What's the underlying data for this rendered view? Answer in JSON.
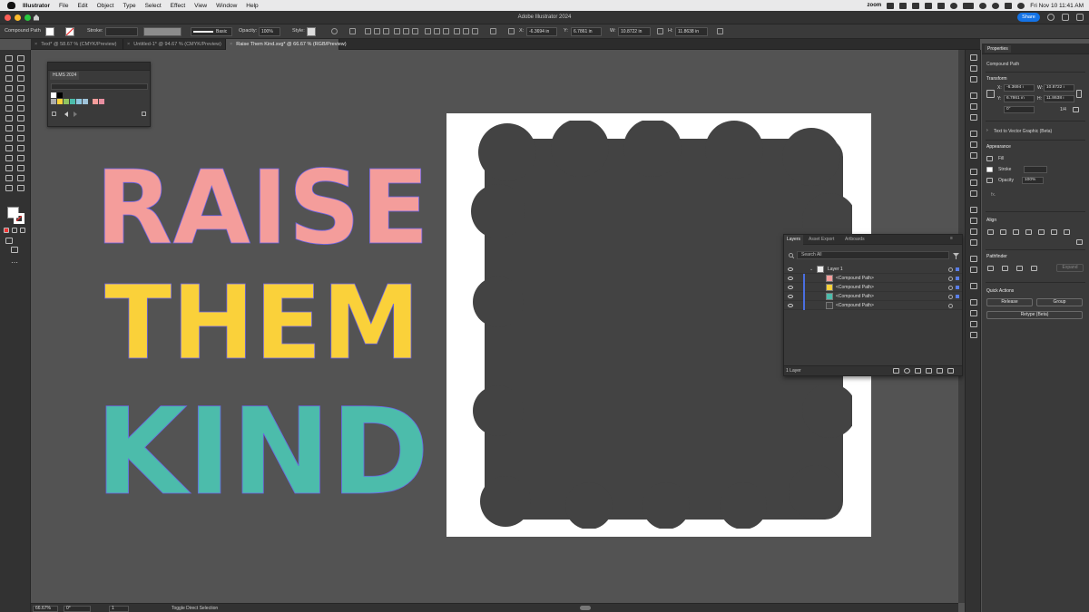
{
  "menubar": {
    "app": "Illustrator",
    "items": [
      "File",
      "Edit",
      "Object",
      "Type",
      "Select",
      "Effect",
      "View",
      "Window",
      "Help"
    ],
    "zoom": "zoom",
    "clock": "Fri Nov 10  11:41 AM"
  },
  "window": {
    "title": "Adobe Illustrator 2024",
    "share": "Share"
  },
  "control": {
    "selection": "Compound Path",
    "stroke_label": "Stroke:",
    "brush": "Basic",
    "opacity_label": "Opacity:",
    "opacity": "100%",
    "style_label": "Style:",
    "x_label": "X:",
    "x": "-6.3694 in",
    "y_label": "Y:",
    "y": "6.7861 in",
    "w_label": "W:",
    "w": "10.8722 in",
    "h_label": "H:",
    "h": "11.8638 in"
  },
  "tabs": [
    "Text* @ 58.67 % (CMYK/Preview)",
    "Untitled-1* @ 94.67 % (CMYK/Preview)",
    "Raise Them Kind.svg* @ 66.67 % (RGB/Preview)"
  ],
  "tab_close": "×",
  "swatches_panel": {
    "title": "HLMS 2024"
  },
  "artwork": {
    "lines": [
      "RAISE",
      "THEM",
      "KIND"
    ],
    "colors": {
      "pink": "#f49d9b",
      "yellow": "#fad13a",
      "teal": "#4cbcab",
      "shadow": "#434343",
      "anchor": "#6b63e6"
    }
  },
  "layers_panel": {
    "tabs": [
      "Layers",
      "Asset Export",
      "Artboards"
    ],
    "search_placeholder": "Search All",
    "layer": "Layer 1",
    "items": [
      "<Compound Path>",
      "<Compound Path>",
      "<Compound Path>",
      "<Compound Path>"
    ],
    "footer": "1 Layer"
  },
  "status": {
    "zoom": "66.67%",
    "rotate": "0°",
    "artboard": "1",
    "tool_hint": "Toggle Direct Selection"
  },
  "properties": {
    "tab": "Properties",
    "selection": "Compound Path",
    "transform": "Transform",
    "x_label": "X:",
    "x": "-6.3694 i",
    "y_label": "Y:",
    "y": "6.7861 in",
    "w_label": "W:",
    "w": "10.8722 i",
    "h_label": "H:",
    "h": "11.8638 i",
    "angle": "0°",
    "ratio": "1/4",
    "vectorize": "Text to Vector Graphic (Beta)",
    "appearance": "Appearance",
    "fill": "Fill",
    "stroke": "Stroke",
    "opacity_label": "Opacity",
    "opacity": "100%",
    "fx": "fx.",
    "align": "Align",
    "pathfinder": "Pathfinder",
    "expand": "Expand",
    "quick_actions": "Quick Actions",
    "release": "Release",
    "group": "Group",
    "retype": "Retype (Beta)"
  }
}
